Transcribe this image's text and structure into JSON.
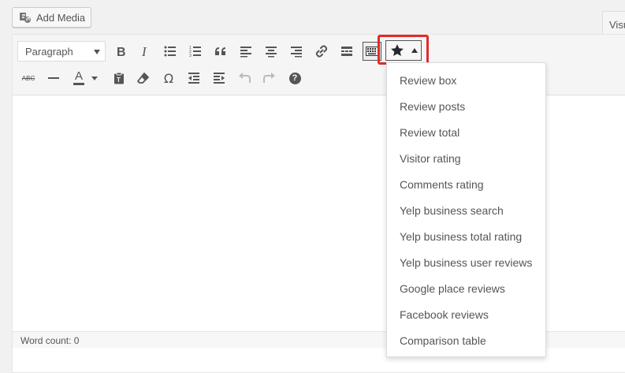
{
  "media": {
    "add_media_label": "Add Media"
  },
  "editor_tabs": {
    "visual_label": "Visu"
  },
  "toolbar": {
    "format_select_value": "Paragraph",
    "strikethrough_glyph": "ABC",
    "text_color_glyph": "A",
    "special_char_glyph": "Ω",
    "help_glyph": "?"
  },
  "review_menu": {
    "items": [
      {
        "label": "Review box"
      },
      {
        "label": "Review posts"
      },
      {
        "label": "Review total"
      },
      {
        "label": "Visitor rating"
      },
      {
        "label": "Comments rating"
      },
      {
        "label": "Yelp business search"
      },
      {
        "label": "Yelp business total rating"
      },
      {
        "label": "Yelp business user reviews"
      },
      {
        "label": "Google place reviews"
      },
      {
        "label": "Facebook reviews"
      },
      {
        "label": "Comparison table"
      }
    ]
  },
  "status": {
    "word_count": "Word count: 0"
  },
  "colors": {
    "highlight": "#e12b2b",
    "icon": "#555555",
    "disabled_icon": "#bbbbbb"
  }
}
